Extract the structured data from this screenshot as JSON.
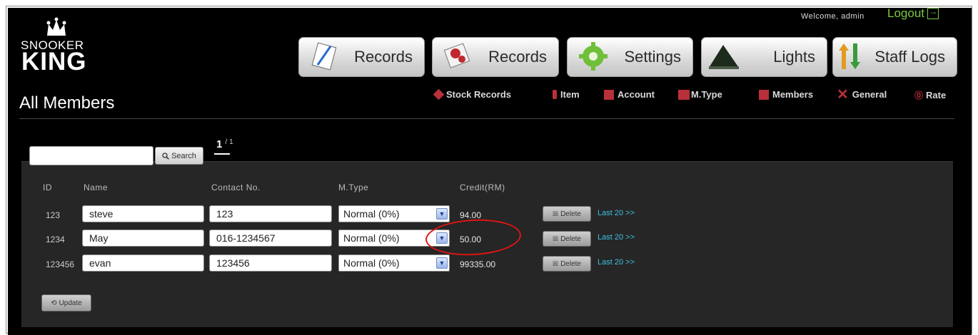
{
  "header": {
    "brand_top": "SNOOKER",
    "brand_bottom": "KING",
    "welcome": "Welcome, admin",
    "logout": "Logout"
  },
  "nav": [
    {
      "label": "Records",
      "icon": "pencil-paper-icon"
    },
    {
      "label": "Records",
      "icon": "snooker-balls-icon"
    },
    {
      "label": "Settings",
      "icon": "gear-icon"
    },
    {
      "label": "Lights",
      "icon": "lamp-icon"
    },
    {
      "label": "Staff Logs",
      "icon": "up-down-arrows-icon"
    }
  ],
  "subnav": [
    {
      "label": "Stock Records",
      "icon": "tag-icon"
    },
    {
      "label": "Item",
      "icon": "bottle-icon"
    },
    {
      "label": "Account",
      "icon": "account-icon"
    },
    {
      "label": "M.Type",
      "icon": "member-type-icon"
    },
    {
      "label": "Members",
      "icon": "members-icon"
    },
    {
      "label": "General",
      "icon": "tools-icon"
    },
    {
      "label": "Rate",
      "icon": "rate-icon"
    }
  ],
  "page": {
    "title": "All Members"
  },
  "search": {
    "value": "",
    "button": "Search"
  },
  "pager": {
    "current": "1",
    "total": "/ 1"
  },
  "table": {
    "headers": [
      "ID",
      "Name",
      "Contact No.",
      "M.Type",
      "Credit(RM)"
    ],
    "rows": [
      {
        "id": "123",
        "name": "steve",
        "contact": "123",
        "mtype": "Normal (0%)",
        "credit": "94.00",
        "delete": "Delete",
        "last": "Last 20 >>"
      },
      {
        "id": "1234",
        "name": "May",
        "contact": "016-1234567",
        "mtype": "Normal (0%)",
        "credit": "50.00",
        "delete": "Delete",
        "last": "Last 20 >>"
      },
      {
        "id": "123456",
        "name": "evan",
        "contact": "123456",
        "mtype": "Normal (0%)",
        "credit": "99335.00",
        "delete": "Delete",
        "last": "Last 20 >>"
      }
    ]
  },
  "update_button": "Update",
  "colors": {
    "accent_green": "#7ac943",
    "link_cyan": "#3ec0e0",
    "highlight_red": "#e01414"
  }
}
